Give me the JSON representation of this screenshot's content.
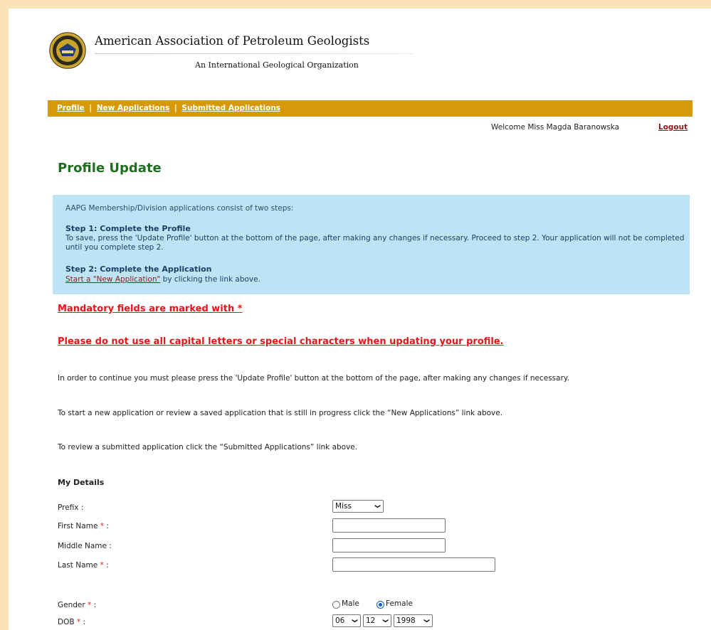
{
  "header": {
    "org_name": "American Association of Petroleum Geologists",
    "tagline": "An International Geological Organization"
  },
  "nav": {
    "profile": "Profile",
    "new_applications": "New Applications",
    "submitted_applications": "Submitted Applications",
    "separator": "|"
  },
  "user": {
    "welcome": "Welcome Miss Magda Baranowska",
    "logout": "Logout"
  },
  "page": {
    "title": "Profile Update"
  },
  "info": {
    "intro": "AAPG Membership/Division applications consist of two steps:",
    "step1_heading": "Step 1: Complete the Profile",
    "step1_text": "To save, press the 'Update Profile' button at the bottom of the page, after making any changes if necessary. Proceed to step 2. Your application will not be completed until you complete step 2.",
    "step2_heading": "Step 2: Complete the Application",
    "step2_link": "Start a \"New Application\"",
    "step2_suffix": " by clicking the link above."
  },
  "warnings": {
    "mandatory": "Mandatory fields are marked with *",
    "capitals": "Please do not use all capital letters or special characters when updating your profile."
  },
  "paragraphs": {
    "p1": "In order to continue you must please press the 'Update Profile' button at the bottom of the page, after making any changes if necessary.",
    "p2": "To start a new application or review a saved application that is still in progress click the “New Applications” link above.",
    "p3": "To review a submitted application click the “Submitted Applications” link above."
  },
  "details": {
    "heading": "My Details",
    "prefix_label": "Prefix :",
    "prefix_value": "Miss",
    "first_name_label": "First Name",
    "middle_name_label": "Middle Name :",
    "last_name_label": "Last Name",
    "gender_label": "Gender",
    "gender_male": "Male",
    "gender_female": "Female",
    "gender_selected": "Female",
    "dob_label": "DOB",
    "dob_day": "06",
    "dob_month": "12",
    "dob_year": "1998",
    "required_mark": "*",
    "colon": " :",
    "first_name_value": "",
    "middle_name_value": "",
    "last_name_value": ""
  },
  "colors": {
    "nav_bar": "#d6990b",
    "page_bg": "#fbe3b9",
    "info_bg": "#bde3f5",
    "title_green": "#1f6e1f",
    "warning_red": "#e3161b"
  }
}
